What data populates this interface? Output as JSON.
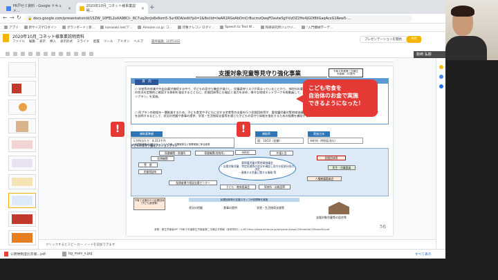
{
  "browser": {
    "tabs": [
      {
        "label": "PR戸ゼミ資料 - Google ドキュメ…",
        "active": false
      },
      {
        "label": "2020年10月_コネット様事業説明…",
        "active": true
      }
    ],
    "url": "docs.google.com/presentation/d/15ZW_10FEL2oXA98Ct-_6C7uq2knJo8x6om5-3url0DA/edit?pli=1&fbclid=IwAR1RGeAbOmCrBucmzQwqFDavlwSgY-tlzDZ2Ho4jGOf8liGaqAcxG1Rew5-…",
    "bookmarks": [
      "アプリ",
      "新サイズゲロダイン",
      "ポランボード | 新…",
      "kanazaki.net/ア…",
      "Amazon.co.jp: コ…",
      "印象ナレコン ログイ…",
      "Speech to Text W…",
      "和楽研究所ジュウジ…",
      "\"入門機械学ーデ…"
    ]
  },
  "docs": {
    "title": "2020年10月_コネット様事業説明資料",
    "menus": [
      "ファイル",
      "編集",
      "表示",
      "挿入",
      "表示形式",
      "スライド",
      "配置",
      "ツール",
      "アドオン",
      "ヘルプ"
    ],
    "last_edit": "最終編集: 10月18日",
    "present_label": "プレゼンテーションを開始",
    "share_label": "共有",
    "notes_placeholder": "クリックするとスピーカー ノートを追加できます"
  },
  "filmstrip": {
    "slide_numbers": [
      "9",
      "10",
      "11",
      "12",
      "13",
      "14",
      "15",
      "16",
      "17",
      "18"
    ]
  },
  "slide": {
    "title": "支援対象児童等見守り強化事業",
    "corner_box": "令和２年度第二次補正\n予算案：31億円",
    "purpose_label": "目　的",
    "purpose_items": [
      "学校等の休業や外出自粛が継続する中で、子どもの見守り機会が減少し、児童虐待リスクが高まっていることから、市町村の要保護児童対策地域協議会が中核となって、支援対象児童等の状況を定期的に確認する体制を強化するとともに、民間団体等にも幅広く協力を求め、様々な地域ネットワークを総動員して、地域の見守り体制をとする「子どもの見守り強化アクションプラン」を実施。",
      "同プランの取組を一層推進するため、子ども食堂や子どもに対する宅食等の支援を行う民間団体等が、要保護児童対策地域協議会の支援対象児童等として登録されている子ども等の居宅を訪問するなどして、状況の把握や食事の提供、学習・生活指導支援等を通じた子どもの見守り体制を強化するための経費を補助する。"
    ],
    "labels": {
      "subsidy": "補助基準額",
      "subsidy_value": "１か所当たり：8,313千円",
      "subsidy_note": "※民間団体等が活動スタッフの人件費、訪問経費など事業実施に係る経費",
      "implementer": "実施主体",
      "implementer_value": "市町村（特別区含む）",
      "rate": "補助率",
      "rate_value": "国：10/10（定額）",
      "diagram_title": "子どもの見守り強化アクションプラン"
    },
    "diagram_nodes": [
      "保健機関・保健所",
      "保健機関(保育所)",
      "医療機関",
      "市町村",
      "弁護士会",
      "警　察",
      "児童相談所",
      "要保護児童対策地域協議会",
      "配偶者暴力相談支援センター",
      "子ども・教育委員会",
      "保育所・幼稚園等",
      "人権擁護委員会",
      "民間団体等",
      "民生・児童委員"
    ],
    "center_node": "要保護児童対策地域協議会\n・支援対象児童、特定妊婦等の状況を確認し見守る役割分担の決定\n・連携する児童に関する事務 等",
    "bottom_items": [
      "子育て支援を行う民間団体（子ども食堂等）",
      "民間団体等の支援スタッフが訪問等を実施",
      "状況の把握",
      "食事の提供",
      "学習・生活指導支援等",
      "支援対象児童等の居宅等"
    ],
    "footer": "参照：厚生労働省HP「令和２年度厚生労働省第二次補正予算案（参考資料）」p.65 https://www.mhlw.go.jp/wp/yosan/yosan/20hosei/dl/20hosei04.pdf",
    "page_number": "56"
  },
  "callout": {
    "text": "こども宅食を\n自治体のお金で実施\nできるようになった！"
  },
  "alerts": [
    "!",
    "!"
  ],
  "video": {
    "name": "駒崎 弘樹"
  },
  "downloads": {
    "items": [
      "公明党制度比京版…pdf",
      "bg_main_s.jpg"
    ],
    "show_all": "すべて表示"
  },
  "colors": {
    "accent": "#f4b400",
    "slide_blue": "#5b9bd5",
    "callout_red": "#e53935"
  }
}
